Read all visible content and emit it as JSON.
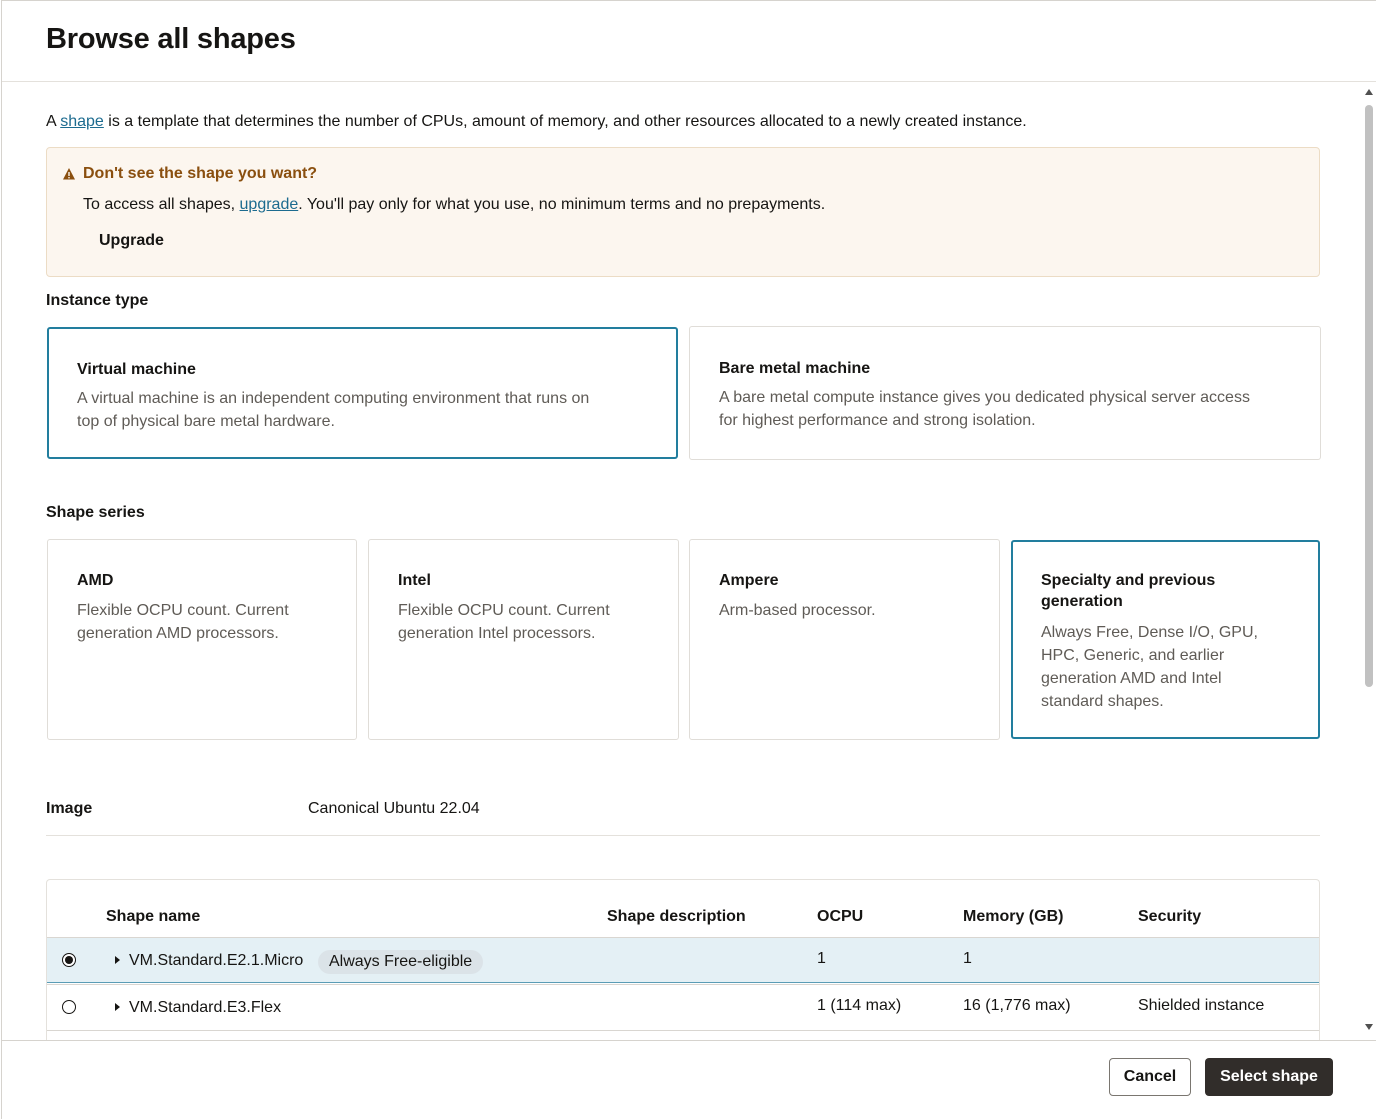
{
  "header": {
    "title": "Browse all shapes"
  },
  "intro": {
    "prefix": "A ",
    "link": "shape",
    "suffix": " is a template that determines the number of CPUs, amount of memory, and other resources allocated to a newly created instance."
  },
  "warning": {
    "title": "Don't see the shape you want?",
    "text_prefix": "To access all shapes, ",
    "text_link": "upgrade",
    "text_suffix": ". You'll pay only for what you use, no minimum terms and no prepayments.",
    "button": "Upgrade",
    "icon": "warning-triangle-icon",
    "color": "#8a4f0f"
  },
  "instance_type": {
    "label": "Instance type",
    "options": [
      {
        "title": "Virtual machine",
        "desc_line1": "A virtual machine is an independent computing environment that runs on",
        "desc_line2": "top of physical bare metal hardware.",
        "selected": true
      },
      {
        "title": "Bare metal machine",
        "desc_line1": "A bare metal compute instance gives you dedicated physical server access",
        "desc_line2": "for highest performance and strong isolation.",
        "selected": false
      }
    ]
  },
  "shape_series": {
    "label": "Shape series",
    "options": [
      {
        "title": "AMD",
        "desc": [
          "Flexible OCPU count. Current",
          "generation AMD processors."
        ],
        "selected": false
      },
      {
        "title": "Intel",
        "desc": [
          "Flexible OCPU count. Current",
          "generation Intel processors."
        ],
        "selected": false
      },
      {
        "title": "Ampere",
        "desc": [
          "Arm-based processor."
        ],
        "selected": false
      },
      {
        "title_line1": "Specialty and previous",
        "title_line2": "generation",
        "desc": [
          "Always Free, Dense I/O, GPU,",
          "HPC, Generic, and earlier",
          "generation AMD and Intel",
          "standard shapes."
        ],
        "selected": true
      }
    ]
  },
  "image": {
    "label": "Image",
    "value": "Canonical Ubuntu 22.04"
  },
  "table": {
    "columns": [
      "Shape name",
      "Shape description",
      "OCPU",
      "Memory (GB)",
      "Security"
    ],
    "rows": [
      {
        "name": "VM.Standard.E2.1.Micro",
        "badge": "Always Free-eligible",
        "description": "",
        "ocpu": "1",
        "memory": "1",
        "security": "",
        "selected": true
      },
      {
        "name": "VM.Standard.E3.Flex",
        "badge": "",
        "description": "",
        "ocpu": "1 (114 max)",
        "memory": "16 (1,776 max)",
        "security": "Shielded instance",
        "selected": false
      }
    ]
  },
  "footer": {
    "cancel": "Cancel",
    "select": "Select shape"
  },
  "colors": {
    "accent": "#227e9e",
    "primary_button": "#312d2a",
    "selected_row": "#e4f0f5",
    "link": "#1c6b8f"
  }
}
